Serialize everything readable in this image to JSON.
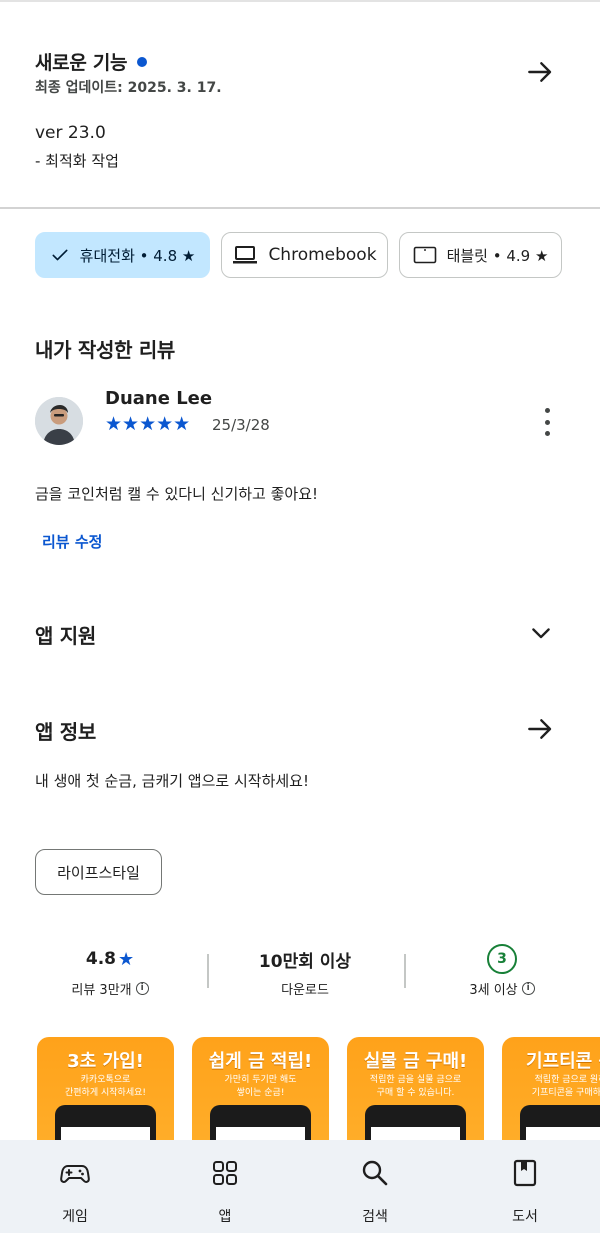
{
  "whats_new": {
    "title": "새로운 기능",
    "updated": "최종 업데이트: 2025. 3. 17.",
    "version": "ver 23.0",
    "note": "- 최적화 작업"
  },
  "devices": [
    {
      "label": "휴대전화 • 4.8 ★",
      "icon": "check-icon",
      "selected": true
    },
    {
      "label": "Chromebook",
      "icon": "laptop-icon",
      "selected": false
    },
    {
      "label": "태블릿 • 4.9 ★",
      "icon": "tablet-icon",
      "selected": false
    }
  ],
  "my_review": {
    "section_title": "내가 작성한 리뷰",
    "reviewer": "Duane Lee",
    "rating": 5,
    "stars": "★★★★★",
    "date": "25/3/28",
    "text": "금을 코인처럼 캘 수 있다니 신기하고 좋아요!",
    "edit_label": "리뷰 수정"
  },
  "app_support": {
    "title": "앱 지원"
  },
  "app_info": {
    "title": "앱 정보",
    "description": "내 생애 첫 순금, 금캐기 앱으로 시작하세요!",
    "category": "라이프스타일"
  },
  "stats": {
    "rating": "4.8",
    "rating_star": "★",
    "reviews_label": "리뷰 3만개",
    "downloads": "10만회 이상",
    "downloads_label": "다운로드",
    "age_badge": "3",
    "age_label": "3세 이상",
    "info_glyph": "i"
  },
  "screenshots": [
    {
      "title": "3초 가입!",
      "subtitle_1": "카카오톡으로",
      "subtitle_2": "간편하게 시작하세요!"
    },
    {
      "title": "쉽게 금 적립!",
      "subtitle_1": "가만히 두기만 해도",
      "subtitle_2": "쌓이는 순금!"
    },
    {
      "title": "실물 금 구매!",
      "subtitle_1": "적립한 금을 실물 금으로",
      "subtitle_2": "구매 할 수 있습니다."
    },
    {
      "title": "기프티콘 구",
      "subtitle_1": "적립한 금으로 원하",
      "subtitle_2": "기프티콘을 구매하세"
    }
  ],
  "bottom_nav": [
    {
      "label": "게임",
      "icon": "gamepad-icon"
    },
    {
      "label": "앱",
      "icon": "apps-grid-icon"
    },
    {
      "label": "검색",
      "icon": "search-icon"
    },
    {
      "label": "도서",
      "icon": "book-icon"
    }
  ],
  "colors": {
    "accent": "#0b57d0",
    "selected_chip": "#c2e7ff",
    "age_green": "#188038",
    "screenshot_orange": "#ffa21a",
    "nav_bg": "#eef2f6"
  }
}
